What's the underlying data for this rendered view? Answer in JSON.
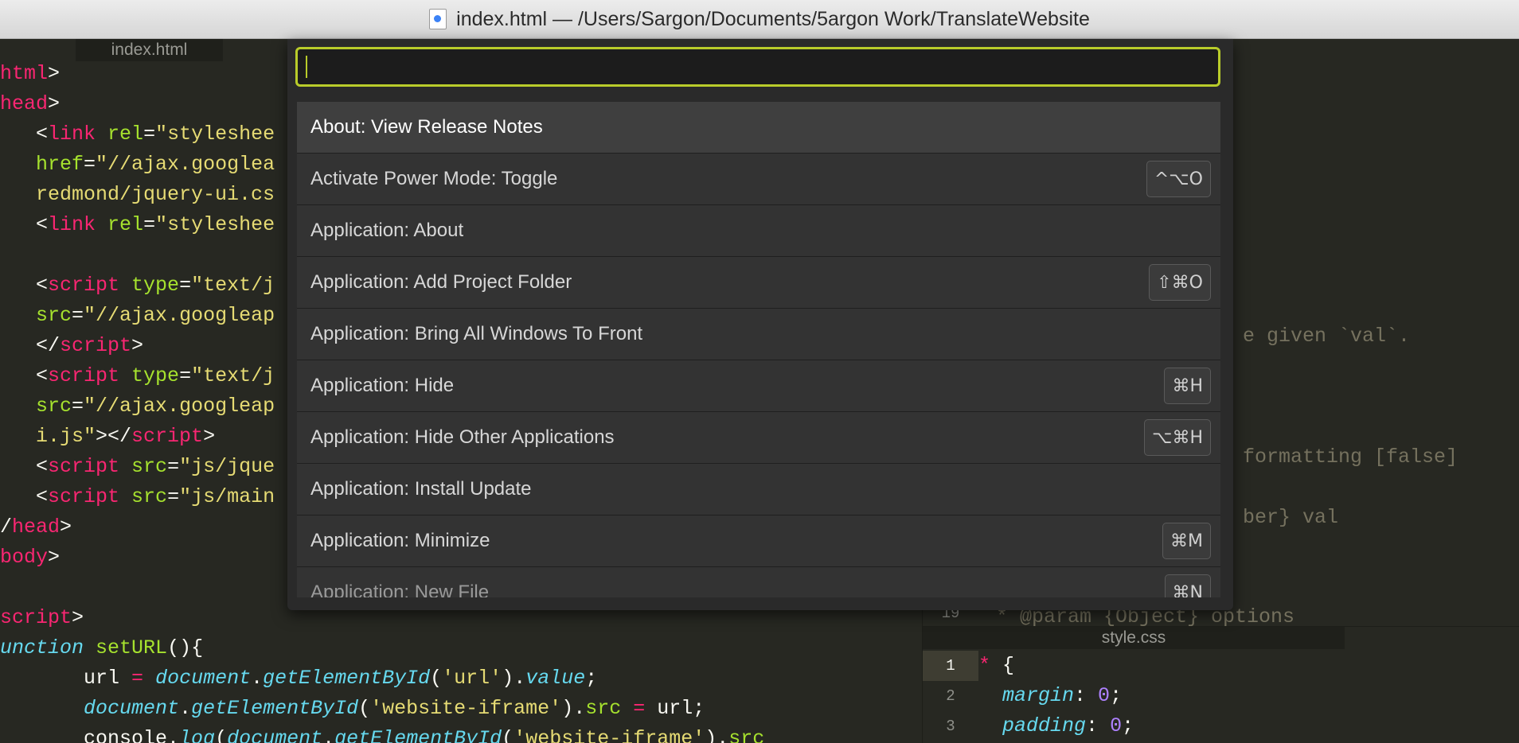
{
  "window": {
    "title": "index.html — /Users/Sargon/Documents/5argon Work/TranslateWebsite"
  },
  "left_pane": {
    "tab_label": "index.html",
    "lines": [
      [
        {
          "t": "html",
          "c": "tg"
        },
        {
          "t": ">",
          "c": "pu"
        }
      ],
      [
        {
          "t": "head",
          "c": "tg"
        },
        {
          "t": ">",
          "c": "pu"
        }
      ],
      [
        {
          "t": "   <",
          "c": "pu"
        },
        {
          "t": "link",
          "c": "tg"
        },
        {
          "t": " ",
          "c": "pu"
        },
        {
          "t": "rel",
          "c": "at"
        },
        {
          "t": "=",
          "c": "pu"
        },
        {
          "t": "\"styleshee",
          "c": "st"
        }
      ],
      [
        {
          "t": "   ",
          "c": "pu"
        },
        {
          "t": "href",
          "c": "at"
        },
        {
          "t": "=",
          "c": "pu"
        },
        {
          "t": "\"//ajax.googlea",
          "c": "st"
        }
      ],
      [
        {
          "t": "   redmond/jquery-ui.cs",
          "c": "st"
        }
      ],
      [
        {
          "t": "   <",
          "c": "pu"
        },
        {
          "t": "link",
          "c": "tg"
        },
        {
          "t": " ",
          "c": "pu"
        },
        {
          "t": "rel",
          "c": "at"
        },
        {
          "t": "=",
          "c": "pu"
        },
        {
          "t": "\"styleshee",
          "c": "st"
        }
      ],
      [
        {
          "t": "",
          "c": "pu"
        }
      ],
      [
        {
          "t": "   <",
          "c": "pu"
        },
        {
          "t": "script",
          "c": "tg"
        },
        {
          "t": " ",
          "c": "pu"
        },
        {
          "t": "type",
          "c": "at"
        },
        {
          "t": "=",
          "c": "pu"
        },
        {
          "t": "\"text/j",
          "c": "st"
        }
      ],
      [
        {
          "t": "   ",
          "c": "pu"
        },
        {
          "t": "src",
          "c": "at"
        },
        {
          "t": "=",
          "c": "pu"
        },
        {
          "t": "\"//ajax.googleap",
          "c": "st"
        }
      ],
      [
        {
          "t": "   </",
          "c": "pu"
        },
        {
          "t": "script",
          "c": "tg"
        },
        {
          "t": ">",
          "c": "pu"
        }
      ],
      [
        {
          "t": "   <",
          "c": "pu"
        },
        {
          "t": "script",
          "c": "tg"
        },
        {
          "t": " ",
          "c": "pu"
        },
        {
          "t": "type",
          "c": "at"
        },
        {
          "t": "=",
          "c": "pu"
        },
        {
          "t": "\"text/j",
          "c": "st"
        }
      ],
      [
        {
          "t": "   ",
          "c": "pu"
        },
        {
          "t": "src",
          "c": "at"
        },
        {
          "t": "=",
          "c": "pu"
        },
        {
          "t": "\"//ajax.googleap",
          "c": "st"
        }
      ],
      [
        {
          "t": "   i.js\"",
          "c": "st"
        },
        {
          "t": "></",
          "c": "pu"
        },
        {
          "t": "script",
          "c": "tg"
        },
        {
          "t": ">",
          "c": "pu"
        }
      ],
      [
        {
          "t": "   <",
          "c": "pu"
        },
        {
          "t": "script",
          "c": "tg"
        },
        {
          "t": " ",
          "c": "pu"
        },
        {
          "t": "src",
          "c": "at"
        },
        {
          "t": "=",
          "c": "pu"
        },
        {
          "t": "\"js/jque",
          "c": "st"
        }
      ],
      [
        {
          "t": "   <",
          "c": "pu"
        },
        {
          "t": "script",
          "c": "tg"
        },
        {
          "t": " ",
          "c": "pu"
        },
        {
          "t": "src",
          "c": "at"
        },
        {
          "t": "=",
          "c": "pu"
        },
        {
          "t": "\"js/main",
          "c": "st"
        }
      ],
      [
        {
          "t": "/",
          "c": "pu"
        },
        {
          "t": "head",
          "c": "tg"
        },
        {
          "t": ">",
          "c": "pu"
        }
      ],
      [
        {
          "t": "body",
          "c": "tg"
        },
        {
          "t": ">",
          "c": "pu"
        }
      ],
      [
        {
          "t": "",
          "c": "pu"
        }
      ],
      [
        {
          "t": "script",
          "c": "tg"
        },
        {
          "t": ">",
          "c": "pu"
        }
      ],
      [
        {
          "t": "unction",
          "c": "kw"
        },
        {
          "t": " ",
          "c": "pu"
        },
        {
          "t": "setURL",
          "c": "fn"
        },
        {
          "t": "(){",
          "c": "pu"
        }
      ],
      [
        {
          "t": "       url ",
          "c": "pu"
        },
        {
          "t": "=",
          "c": "tg"
        },
        {
          "t": " ",
          "c": "pu"
        },
        {
          "t": "document",
          "c": "kw"
        },
        {
          "t": ".",
          "c": "pu"
        },
        {
          "t": "getElementById",
          "c": "kw"
        },
        {
          "t": "(",
          "c": "pu"
        },
        {
          "t": "'url'",
          "c": "st"
        },
        {
          "t": ").",
          "c": "pu"
        },
        {
          "t": "value",
          "c": "kw"
        },
        {
          "t": ";",
          "c": "pu"
        }
      ],
      [
        {
          "t": "       ",
          "c": "pu"
        },
        {
          "t": "document",
          "c": "kw"
        },
        {
          "t": ".",
          "c": "pu"
        },
        {
          "t": "getElementById",
          "c": "kw"
        },
        {
          "t": "(",
          "c": "pu"
        },
        {
          "t": "'website-iframe'",
          "c": "st"
        },
        {
          "t": ").",
          "c": "pu"
        },
        {
          "t": "src",
          "c": "at"
        },
        {
          "t": " ",
          "c": "pu"
        },
        {
          "t": "=",
          "c": "tg"
        },
        {
          "t": " url;",
          "c": "pu"
        }
      ],
      [
        {
          "t": "       console.",
          "c": "pu"
        },
        {
          "t": "log",
          "c": "kw"
        },
        {
          "t": "(",
          "c": "pu"
        },
        {
          "t": "document",
          "c": "kw"
        },
        {
          "t": ".",
          "c": "pu"
        },
        {
          "t": "getElementById",
          "c": "kw"
        },
        {
          "t": "(",
          "c": "pu"
        },
        {
          "t": "'website-iframe'",
          "c": "st"
        },
        {
          "t": ").",
          "c": "pu"
        },
        {
          "t": "src",
          "c": "at"
        }
      ]
    ]
  },
  "right_top": {
    "visible_line_number": "19",
    "fragments": [
      {
        "text": "e given `val`.",
        "row": 10
      },
      {
        "text": "formatting [false]",
        "row": 14
      },
      {
        "text": "ber} val",
        "row": 16
      },
      {
        "text": "* @param {Object} options",
        "row": 17
      }
    ]
  },
  "right_bottom": {
    "tab_label": "style.css",
    "line_numbers": [
      "1",
      "2",
      "3"
    ],
    "lines": [
      [
        {
          "t": "* ",
          "c": "tg"
        },
        {
          "t": "{",
          "c": "pu"
        }
      ],
      [
        {
          "t": "  ",
          "c": "pu"
        },
        {
          "t": "margin",
          "c": "kw"
        },
        {
          "t": ": ",
          "c": "pu"
        },
        {
          "t": "0",
          "c": "nm"
        },
        {
          "t": ";",
          "c": "pu"
        }
      ],
      [
        {
          "t": "  ",
          "c": "pu"
        },
        {
          "t": "padding",
          "c": "kw"
        },
        {
          "t": ": ",
          "c": "pu"
        },
        {
          "t": "0",
          "c": "nm"
        },
        {
          "t": ";",
          "c": "pu"
        }
      ]
    ]
  },
  "palette": {
    "query": "",
    "items": [
      {
        "label": "About: View Release Notes",
        "shortcut": "",
        "selected": true
      },
      {
        "label": "Activate Power Mode: Toggle",
        "shortcut": "^⌥O"
      },
      {
        "label": "Application: About",
        "shortcut": ""
      },
      {
        "label": "Application: Add Project Folder",
        "shortcut": "⇧⌘O"
      },
      {
        "label": "Application: Bring All Windows To Front",
        "shortcut": ""
      },
      {
        "label": "Application: Hide",
        "shortcut": "⌘H"
      },
      {
        "label": "Application: Hide Other Applications",
        "shortcut": "⌥⌘H"
      },
      {
        "label": "Application: Install Update",
        "shortcut": ""
      },
      {
        "label": "Application: Minimize",
        "shortcut": "⌘M"
      },
      {
        "label": "Application: New File",
        "shortcut": "⌘N",
        "partial": true
      }
    ]
  },
  "colors": {
    "editor_bg": "#272822",
    "palette_focus": "#b9cc2a"
  }
}
